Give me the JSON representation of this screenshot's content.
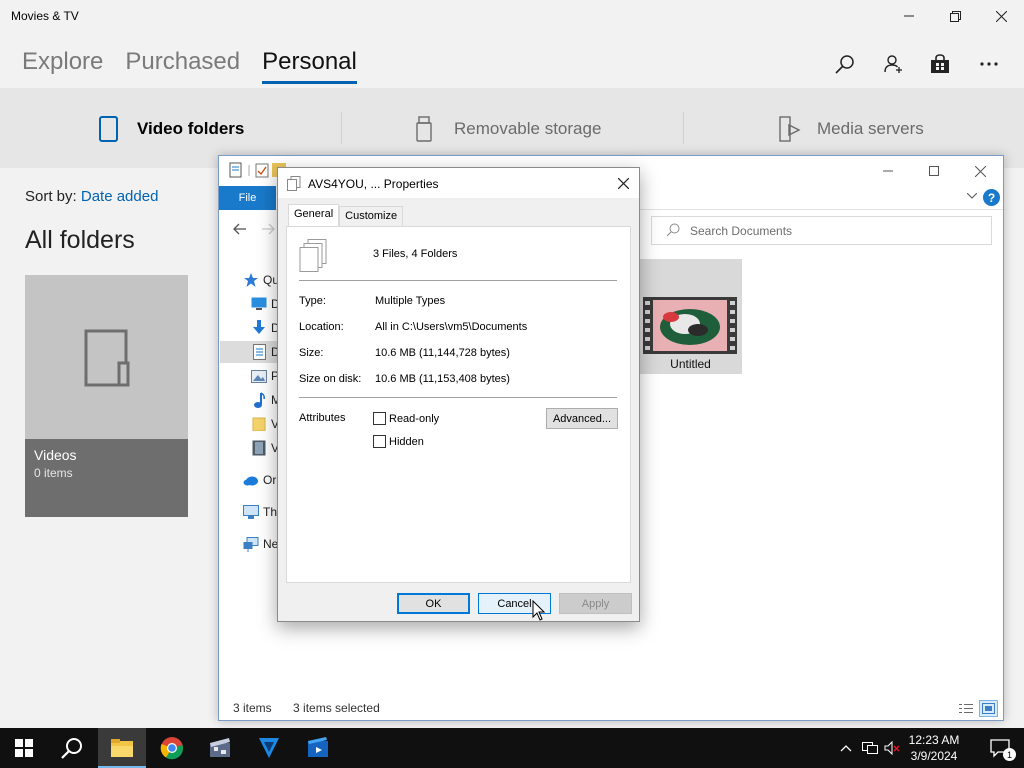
{
  "app": {
    "title": "Movies & TV",
    "tabs": [
      "Explore",
      "Purchased",
      "Personal"
    ],
    "active_tab": "Personal",
    "subnav": [
      "Video folders",
      "Removable storage",
      "Media servers"
    ],
    "sort_label": "Sort by:",
    "sort_value": "Date added",
    "section_title": "All folders",
    "folder": {
      "name": "Videos",
      "count": "0 items"
    }
  },
  "explorer": {
    "ribbon_file": "File",
    "search_placeholder": "Search Documents",
    "tree": [
      "Qu",
      "D",
      "D",
      "D",
      "P",
      "M",
      "V",
      "V",
      "Or",
      "Th",
      "Ne"
    ],
    "item": {
      "name": "Untitled"
    },
    "status": {
      "items": "3 items",
      "selected": "3 items selected"
    }
  },
  "dialog": {
    "title": "AVS4YOU, ... Properties",
    "tabs": [
      "General",
      "Customize"
    ],
    "summary": "3 Files, 4 Folders",
    "rows": [
      {
        "label": "Type:",
        "value": "Multiple Types"
      },
      {
        "label": "Location:",
        "value": "All in C:\\Users\\vm5\\Documents"
      },
      {
        "label": "Size:",
        "value": "10.6 MB (11,144,728 bytes)"
      },
      {
        "label": "Size on disk:",
        "value": "10.6 MB (11,153,408 bytes)"
      }
    ],
    "attributes_label": "Attributes",
    "readonly_label": "Read-only",
    "hidden_label": "Hidden",
    "advanced_label": "Advanced...",
    "ok_label": "OK",
    "cancel_label": "Cancel",
    "apply_label": "Apply"
  },
  "taskbar": {
    "time": "12:23 AM",
    "date": "3/9/2024",
    "notification_count": "1"
  },
  "colors": {
    "accent": "#0063b1",
    "explorer_blue": "#1979ca",
    "taskbar": "#101010"
  }
}
